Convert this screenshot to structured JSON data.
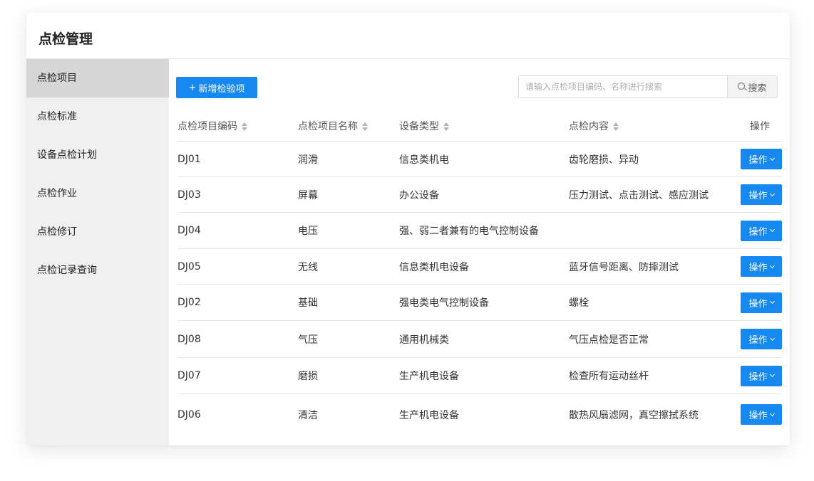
{
  "page": {
    "title": "点检管理"
  },
  "sidebar": {
    "items": [
      {
        "label": "点检项目",
        "active": true
      },
      {
        "label": "点检标准"
      },
      {
        "label": "设备点检计划"
      },
      {
        "label": "点检作业"
      },
      {
        "label": "点检修订"
      },
      {
        "label": "点检记录查询"
      }
    ]
  },
  "toolbar": {
    "add_icon": "+",
    "add_label": "新增检验项",
    "search_placeholder": "请输入点检项目编码、名称进行搜索",
    "search_value": "",
    "search_label": "搜索"
  },
  "table": {
    "columns": [
      "点检项目编码",
      "点检项目名称",
      "设备类型",
      "点检内容",
      "操作"
    ],
    "rows": [
      {
        "code": "DJ01",
        "name": "润滑",
        "type": "信息类机电",
        "content": "齿轮磨损、异动",
        "op": "操作"
      },
      {
        "code": "DJ03",
        "name": "屏幕",
        "type": "办公设备",
        "content": "压力测试、点击测试、感应测试",
        "op": "操作"
      },
      {
        "code": "DJ04",
        "name": "电压",
        "type": "强、弱二者兼有的电气控制设备",
        "content": "",
        "op": "操作"
      },
      {
        "code": "DJ05",
        "name": "无线",
        "type": "信息类机电设备",
        "content": "蓝牙信号距离、防摔测试",
        "op": "操作"
      },
      {
        "code": "DJ02",
        "name": "基础",
        "type": "强电类电气控制设备",
        "content": "螺栓",
        "op": "操作"
      },
      {
        "code": "DJ08",
        "name": "气压",
        "type": "通用机械类",
        "content": "气压点检是否正常",
        "op": "操作"
      },
      {
        "code": "DJ07",
        "name": "磨损",
        "type": "生产机电设备",
        "content": "检查所有运动丝杆",
        "op": "操作"
      },
      {
        "code": "DJ06",
        "name": "清洁",
        "type": "生产机电设备",
        "content": "散热风扇滤网，真空擦拭系统",
        "op": "操作"
      }
    ]
  },
  "colors": {
    "primary": "#1689f0",
    "sidebar_bg": "#f0f0f0",
    "sidebar_active": "#d6d6d6"
  }
}
